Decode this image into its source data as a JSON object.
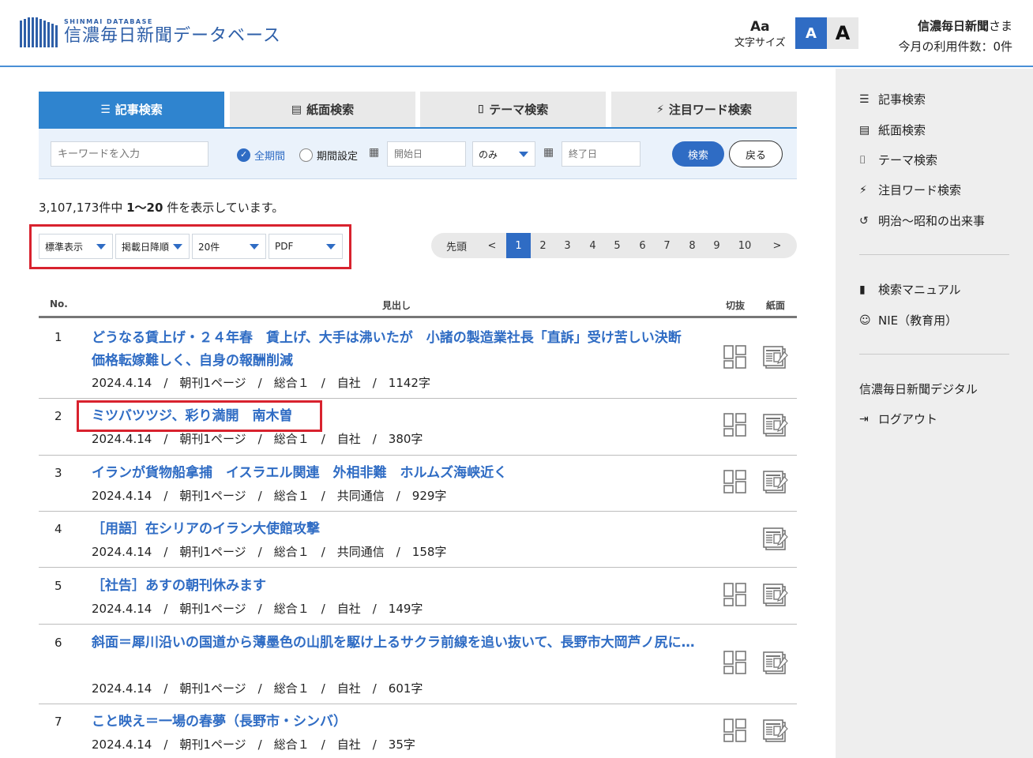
{
  "header": {
    "logo_sub": "SHINMAI DATABASE",
    "logo_main": "信濃毎日新聞データベース",
    "font_size_label": "文字サイズ",
    "font_size_icon": "Aa",
    "font_small": "A",
    "font_large": "A",
    "user_name": "信濃毎日新聞",
    "user_suffix": "さま",
    "usage": "今月の利用件数：0件"
  },
  "tabs": [
    {
      "label": "記事検索",
      "icon": "list-icon",
      "glyph": "☰"
    },
    {
      "label": "紙面検索",
      "icon": "newspaper-icon",
      "glyph": "▤"
    },
    {
      "label": "テーマ検索",
      "icon": "bookmark-icon",
      "glyph": "⌷"
    },
    {
      "label": "注目ワード検索",
      "icon": "bolt-icon",
      "glyph": "⚡"
    }
  ],
  "search": {
    "keyword_placeholder": "キーワードを入力",
    "all_period": "全期間",
    "period_setting": "期間設定",
    "start_placeholder": "開始日",
    "mode_value": "のみ",
    "end_placeholder": "終了日",
    "search_button": "検索",
    "back_button": "戻る"
  },
  "result": {
    "total": "3,107,173件中",
    "range": "1〜20",
    "suffix": "件を表示しています。"
  },
  "controls": {
    "display": "標準表示",
    "sort": "掲載日降順",
    "per_page": "20件",
    "format": "PDF"
  },
  "pager": {
    "first": "先頭",
    "prev": "<",
    "next": ">",
    "pages": [
      "1",
      "2",
      "3",
      "4",
      "5",
      "6",
      "7",
      "8",
      "9",
      "10"
    ],
    "current": "1"
  },
  "table": {
    "col_no": "No.",
    "col_title": "見出し",
    "col_clip": "切抜",
    "col_paper": "紙面",
    "rows": [
      {
        "no": "1",
        "title": "どうなる賃上げ・２４年春　賃上げ、大手は沸いたが　小諸の製造業社長「直訴」受け苦しい決断　価格転嫁難しく、自身の報酬削減",
        "meta": "2024.4.14　/　朝刊1ページ　/　総合１　/　自社　/　1142字",
        "clip": true
      },
      {
        "no": "2",
        "title": "ミツバツツジ、彩り満開　南木曽",
        "meta": "2024.4.14　/　朝刊1ページ　/　総合１　/　自社　/　380字",
        "clip": true
      },
      {
        "no": "3",
        "title": "イランが貨物船拿捕　イスラエル関連　外相非難　ホルムズ海峡近く",
        "meta": "2024.4.14　/　朝刊1ページ　/　総合１　/　共同通信　/　929字",
        "clip": true
      },
      {
        "no": "4",
        "title": "［用語］在シリアのイラン大使館攻撃",
        "meta": "2024.4.14　/　朝刊1ページ　/　総合１　/　共同通信　/　158字",
        "clip": false
      },
      {
        "no": "5",
        "title": "［社告］あすの朝刊休みます",
        "meta": "2024.4.14　/　朝刊1ページ　/　総合１　/　自社　/　149字",
        "clip": true
      },
      {
        "no": "6",
        "title": "斜面＝犀川沿いの国道から薄墨色の山肌を駆け上るサクラ前線を追い抜いて、長野市大岡芦ノ尻に…",
        "meta": "2024.4.14　/　朝刊1ページ　/　総合１　/　自社　/　601字",
        "clip": true
      },
      {
        "no": "7",
        "title": "こと映え＝一場の春夢（長野市・シンバ）",
        "meta": "2024.4.14　/　朝刊1ページ　/　総合１　/　自社　/　35字",
        "clip": true
      }
    ]
  },
  "sidebar": {
    "items": [
      {
        "label": "記事検索",
        "icon": "list-icon",
        "glyph": "☰"
      },
      {
        "label": "紙面検索",
        "icon": "newspaper-icon",
        "glyph": "▤"
      },
      {
        "label": "テーマ検索",
        "icon": "bookmark-icon",
        "glyph": "⌷"
      },
      {
        "label": "注目ワード検索",
        "icon": "bolt-icon",
        "glyph": "⚡"
      },
      {
        "label": "明治〜昭和の出来事",
        "icon": "history-icon",
        "glyph": "↺"
      },
      {
        "label": "検索マニュアル",
        "icon": "book-icon",
        "glyph": "▮"
      },
      {
        "label": "NIE（教育用）",
        "icon": "face-icon",
        "glyph": "☺"
      },
      {
        "label": "信濃毎日新聞デジタル",
        "icon": "",
        "glyph": ""
      },
      {
        "label": "ログアウト",
        "icon": "logout-icon",
        "glyph": "⇥"
      }
    ]
  },
  "colors": {
    "accent": "#2f6cc4",
    "tab_active": "#2f84cf",
    "highlight": "#d8222e",
    "sidebar_bg": "#eeeeee"
  }
}
